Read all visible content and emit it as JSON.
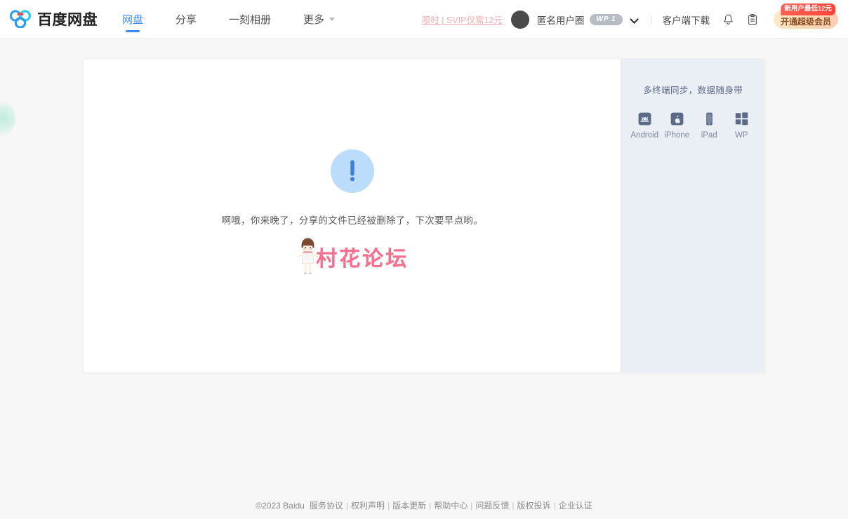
{
  "header": {
    "logo_icon": "baidu-netdisk-logo-icon",
    "logo_text": "百度网盘",
    "nav": [
      {
        "label": "网盘",
        "active": true
      },
      {
        "label": "分享",
        "active": false
      },
      {
        "label": "一刻相册",
        "active": false
      },
      {
        "label": "更多",
        "active": false,
        "has_caret": true
      }
    ],
    "promo_link": "限时 | SVIP仅需12元",
    "avatar_icon": "avatar",
    "username": "匿名用户圈",
    "user_badge": "WP 1",
    "user_caret_icon": "chevron-down-icon",
    "client_download": "客户端下载",
    "bell_icon": "bell-icon",
    "clipboard_icon": "clipboard-icon",
    "vip_button_label": "开通超级会员",
    "vip_badge_label": "新用户最低12元"
  },
  "main": {
    "error_icon": "exclamation-icon",
    "error_message": "啊哦，你来晚了，分享的文件已经被删除了，下次要早点哟。",
    "watermark_text": "村花论坛",
    "watermark_figure_icon": "girl-mascot-icon"
  },
  "sidebar": {
    "title": "多终端同步，数据随身带",
    "platforms": [
      {
        "label": "Android",
        "icon": "android-icon"
      },
      {
        "label": "iPhone",
        "icon": "iphone-icon"
      },
      {
        "label": "iPad",
        "icon": "ipad-icon"
      },
      {
        "label": "WP",
        "icon": "windows-phone-icon"
      }
    ]
  },
  "footer": {
    "copyright": "©2023 Baidu",
    "links": [
      "服务协议",
      "权利声明",
      "版本更新",
      "帮助中心",
      "问题反馈",
      "版权投诉",
      "企业认证"
    ]
  },
  "colors": {
    "accent_blue": "#3b8cff",
    "error_circle": "#bcdcfb",
    "error_glyph": "#3b7fe0",
    "sidebar_bg": "#eaeef5",
    "page_bg": "#f7f7f7",
    "promo_pink": "#f0a0a5",
    "watermark_pink": "#f4708f",
    "vip_badge_red": "#f8453c"
  }
}
